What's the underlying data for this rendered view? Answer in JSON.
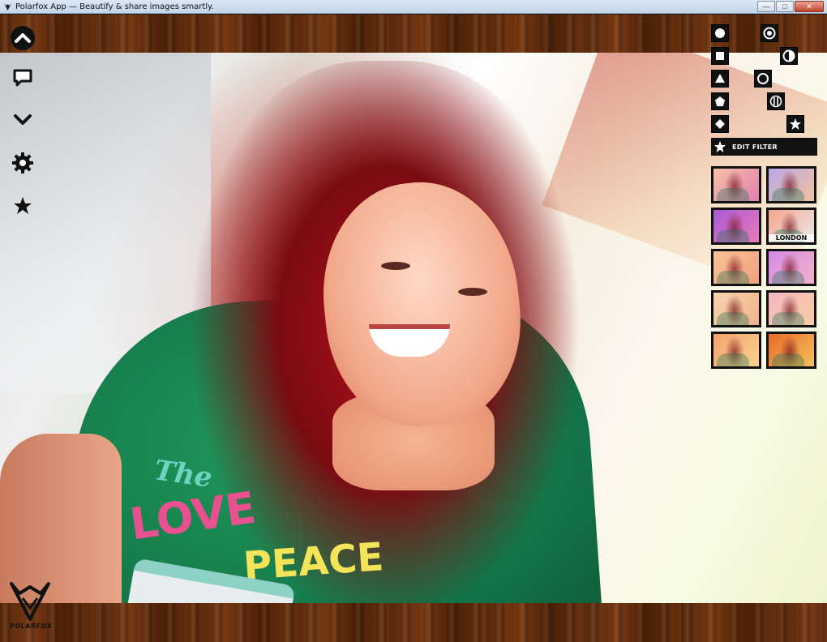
{
  "window": {
    "title": "Polarfox App — Beautify & share images smartly.",
    "controls": [
      "minimize",
      "maximize",
      "close"
    ]
  },
  "left_toolbar": {
    "icons": [
      "chevron-up-icon",
      "comment-icon",
      "chevron-down-icon",
      "gear-icon",
      "star-icon"
    ]
  },
  "logo": {
    "text": "POLARFOX"
  },
  "shape_panel": {
    "left_column": [
      "circle-filled",
      "square",
      "triangle",
      "pentagon",
      "diamond"
    ],
    "right_column": [
      "circle-target",
      "half-circle",
      "circle-outline",
      "circle-striped",
      "star"
    ]
  },
  "edit_filter": {
    "label": "EDIT FILTER"
  },
  "filters": [
    {
      "label": "",
      "tint": [
        "#f7c2a8",
        "#e07eb0"
      ]
    },
    {
      "label": "",
      "tint": [
        "#b8a8e8",
        "#f3c0a0"
      ]
    },
    {
      "label": "",
      "tint": [
        "#a85bd6",
        "#e87ab8"
      ]
    },
    {
      "label": "LONDON",
      "tint": [
        "#f5a48e",
        "#e9e9e9"
      ]
    },
    {
      "label": "",
      "tint": [
        "#f8c497",
        "#f2a07a"
      ]
    },
    {
      "label": "",
      "tint": [
        "#d48be6",
        "#f2b1c8"
      ]
    },
    {
      "label": "",
      "tint": [
        "#f7d5b0",
        "#f0b28a"
      ]
    },
    {
      "label": "",
      "tint": [
        "#f4b7c5",
        "#f7cda0"
      ]
    },
    {
      "label": "",
      "tint": [
        "#f6a16a",
        "#f7d390"
      ]
    },
    {
      "label": "",
      "tint": [
        "#e86a2a",
        "#f6c15a"
      ]
    }
  ],
  "colors": {
    "panel_bg": "#111111",
    "wood": "#6b3412",
    "accent": "#ffffff"
  }
}
